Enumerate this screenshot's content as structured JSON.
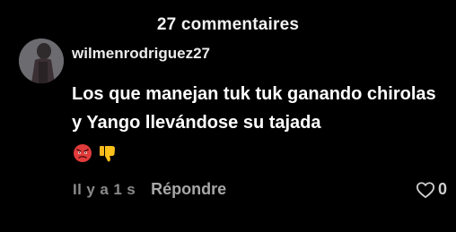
{
  "header": {
    "title": "27 commentaires"
  },
  "comment": {
    "username": "wilmenrodriguez27",
    "text": "Los que manejan tuk tuk ganando chirolas y Yango llevándose su tajada",
    "reactions": [
      "angry-face-icon",
      "thumbs-down-icon"
    ],
    "timestamp": "Il y a 1 s",
    "reply_label": "Répondre",
    "like_count": "0"
  },
  "colors": {
    "background": "#000000",
    "text_primary": "#ffffff",
    "text_secondary": "#a7a7a7",
    "timestamp": "#8a8a8a"
  }
}
